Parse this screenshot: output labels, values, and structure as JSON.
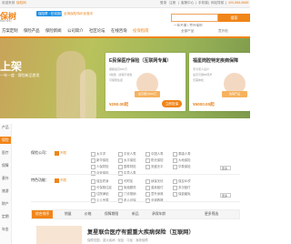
{
  "topbar": {
    "left_items": [
      "欢迎来到",
      "保险网"
    ],
    "right_items": [
      "登录",
      "注册",
      "|",
      "客服中心",
      "|",
      "手机端",
      "|",
      "网站导航",
      "|",
      "400-888-8888"
    ]
  },
  "header": {
    "logo": "保树",
    "logo_sub": "bao shu",
    "promo_pill": "保险帮 · 在线投保",
    "promo_link": "全场保险特价优惠中"
  },
  "search": {
    "placeholder": "一年不重 | 意外保险",
    "button": "搜索"
  },
  "nav": {
    "items": [
      "方案定制",
      "保险产品",
      "保险新闻",
      "公司简介",
      "社区论坛",
      "在线咨询",
      "投保指南"
    ],
    "active_index": 6,
    "right": [
      "全部产品",
      "意外险"
    ]
  },
  "banner": {
    "hero": "上架",
    "hero_sub": "一年一度 · 保险新品首发",
    "cards": [
      {
        "title": "E民保医疗保险（互联网专属）",
        "lines": [
          "保额最高600万",
          "0免赔 · 续保不健告",
          "可保既往症"
        ],
        "badge": "最高赔付600万",
        "price": "¥290.00起",
        "button": "立即投保"
      },
      {
        "title": "福星岗腔特定疾病保障",
        "lines": [
          "专为老人设计",
          "最高可保80周岁",
          "无需体检"
        ],
        "badge": "热销产品",
        "price": "¥5000.00起",
        "button": "立即投保"
      }
    ]
  },
  "side": {
    "items": [
      "产品",
      "",
      "保险",
      "",
      "医疗",
      "",
      "保障",
      "",
      "意外",
      "",
      "旅游",
      "",
      "财产",
      "",
      "定期",
      "",
      "年金"
    ],
    "active_index": 2
  },
  "filters": {
    "rows": [
      {
        "label": "保险公司：",
        "options": [
          "不限",
          "太平洋",
          "平安人寿",
          "中国人寿",
          "泰康人寿",
          "新华保险",
          "太平保险",
          "阳光保险",
          "大地保险",
          "人保财险",
          "国寿财险",
          "安盛天平",
          "华泰保险",
          "众安保险",
          "中意人寿"
        ]
      },
      {
        "label": "特色功能：",
        "options": [
          "不限",
          "保至终身",
          "可附加",
          "续保无忧",
          "保至80岁",
          "可保既往症",
          "免赔额低",
          "重疾赔付",
          "多次赔付",
          "住院津贴",
          "门诊报销",
          "意外身故",
          "保费豁免",
          "少儿专属",
          "老人可保",
          "全球救援"
        ]
      }
    ],
    "dropdown": "更多"
  },
  "sortbar": {
    "items": [
      "综合排序",
      "销量",
      "价格",
      "保障期限",
      "新品",
      "承保年龄",
      "更多筛选"
    ],
    "active_index": 0
  },
  "product": {
    "title": "复星联合医疗有盟重大疾病保险（互联网）",
    "sub": "保障范围：重大疾病 · 轻症 · 中症 · 身故保障"
  },
  "colors": {
    "accent": "#f08519",
    "link": "#3a7bd5"
  }
}
